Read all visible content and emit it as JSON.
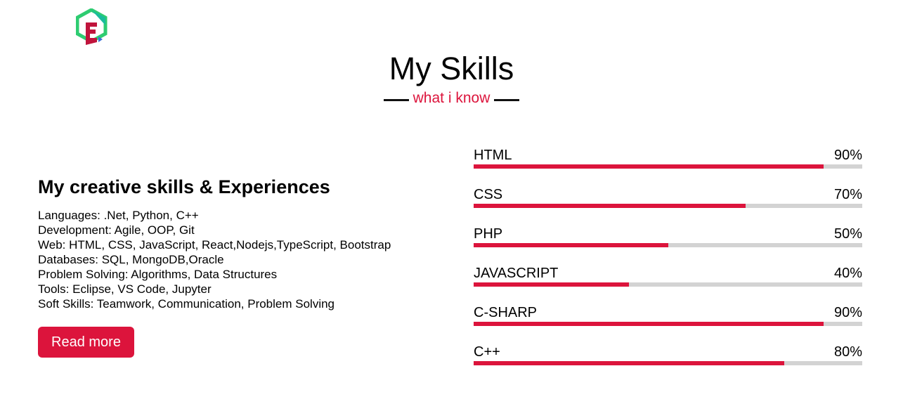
{
  "header": {
    "title": "My Skills",
    "subtitle": "what i know"
  },
  "colors": {
    "accent": "#dc143c",
    "track": "#d3d3d3",
    "logo_green": "#2ecc71",
    "logo_teal": "#1abc9c",
    "logo_red": "#c0143c",
    "logo_blue": "#3a6fd8"
  },
  "about": {
    "heading": "My creative skills & Experiences",
    "lines": [
      "Languages: .Net, Python, C++",
      "Development: Agile, OOP, Git",
      "Web: HTML, CSS, JavaScript, React,Nodejs,TypeScript, Bootstrap",
      "Databases: SQL, MongoDB,Oracle",
      "Problem Solving: Algorithms, Data Structures",
      "Tools: Eclipse, VS Code, Jupyter",
      "Soft Skills: Teamwork, Communication, Problem Solving"
    ],
    "button_label": "Read more"
  },
  "skills": [
    {
      "name": "HTML",
      "percent_label": "90%",
      "level": 0.9
    },
    {
      "name": "CSS",
      "percent_label": "70%",
      "level": 0.7
    },
    {
      "name": "PHP",
      "percent_label": "50%",
      "level": 0.5
    },
    {
      "name": "JAVASCRIPT",
      "percent_label": "40%",
      "level": 0.4
    },
    {
      "name": "C-SHARP",
      "percent_label": "90%",
      "level": 0.9
    },
    {
      "name": "C++",
      "percent_label": "80%",
      "level": 0.8
    }
  ]
}
